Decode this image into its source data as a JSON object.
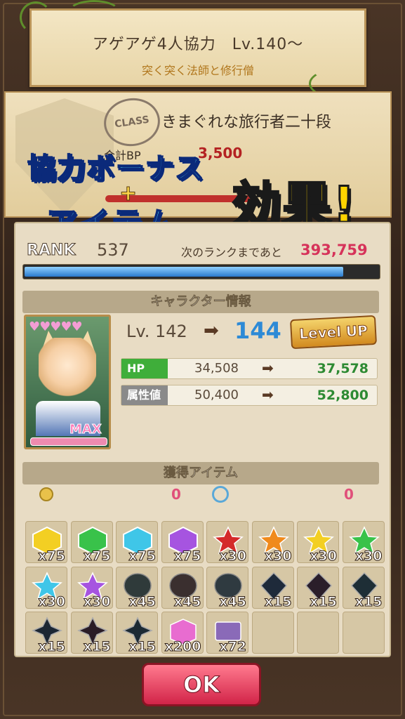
{
  "header": {
    "title": "アゲアゲ4人協力　Lv.140～",
    "subtitle": "突く突く法師と修行僧"
  },
  "class_panel": {
    "stamp": "CLASS",
    "class_name": "きまぐれな旅行者二十段",
    "bp_label": "合計BP",
    "bp_value": "3,500"
  },
  "overlay": {
    "line1": "協力ボーナス",
    "plus": "+",
    "line2": "アイテム",
    "line3": "効果!"
  },
  "rank": {
    "label": "RANK",
    "value": "537",
    "next_label": "次のランクまであと",
    "next_value": "393,759",
    "progress": 0.9
  },
  "character": {
    "section_title": "キャラクター情報",
    "hearts": "♥♥♥♥♥",
    "max_badge": "MAX",
    "level_old": "Lv. 142",
    "level_new": "144",
    "levelup_badge": "Level UP",
    "stats": [
      {
        "label": "HP",
        "old": "34,508",
        "new": "37,578",
        "color": "#3fae3a"
      },
      {
        "label": "属性値",
        "old": "50,400",
        "new": "52,800",
        "color": "#8a8a8a"
      }
    ]
  },
  "items": {
    "section_title": "獲得アイテム",
    "currency": [
      {
        "icon": "coin-icon",
        "value": "0"
      },
      {
        "icon": "swirl-icon",
        "value": "0"
      }
    ],
    "grid": [
      {
        "name": "yellow-gem-icon",
        "color": "#f3cf23",
        "qty": "x75"
      },
      {
        "name": "green-gem-icon",
        "color": "#39c24a",
        "qty": "x75"
      },
      {
        "name": "cyan-gem-icon",
        "color": "#3fc6e8",
        "qty": "x75"
      },
      {
        "name": "purple-gem-icon",
        "color": "#a654e0",
        "qty": "x75"
      },
      {
        "name": "red-star-icon",
        "color": "#d42a2a",
        "qty": "x30"
      },
      {
        "name": "orange-star-icon",
        "color": "#f08a1c",
        "qty": "x30"
      },
      {
        "name": "yellow-star-icon",
        "color": "#f3cf23",
        "qty": "x30"
      },
      {
        "name": "green-star-icon",
        "color": "#39c24a",
        "qty": "x30"
      },
      {
        "name": "cyan-star-icon",
        "color": "#3fc6e8",
        "qty": "x30"
      },
      {
        "name": "purple-star-icon",
        "color": "#a654e0",
        "qty": "x30"
      },
      {
        "name": "dark-orb-green-icon",
        "color": "#2f3a3a",
        "qty": "x45"
      },
      {
        "name": "dark-orb-orange-icon",
        "color": "#3a2f2f",
        "qty": "x45"
      },
      {
        "name": "dark-orb-cyan-icon",
        "color": "#2f3a40",
        "qty": "x45"
      },
      {
        "name": "dark-crystal-green-icon",
        "color": "#1e2a3a",
        "qty": "x15"
      },
      {
        "name": "dark-crystal-orange-icon",
        "color": "#2a1e2a",
        "qty": "x15"
      },
      {
        "name": "dark-crystal-cyan-icon",
        "color": "#1e2e36",
        "qty": "x15"
      },
      {
        "name": "dark-shard-green-icon",
        "color": "#1c2733",
        "qty": "x15"
      },
      {
        "name": "dark-shard-orange-icon",
        "color": "#2a1c26",
        "qty": "x15"
      },
      {
        "name": "dark-shard-cyan-icon",
        "color": "#1c2a33",
        "qty": "x15"
      },
      {
        "name": "rainbow-cube-icon",
        "color": "#e86cd0",
        "qty": "x200"
      },
      {
        "name": "ticket-icon",
        "color": "#8a6ab8",
        "qty": "x72"
      },
      {
        "name": "empty-slot",
        "color": "",
        "qty": ""
      },
      {
        "name": "empty-slot",
        "color": "",
        "qty": ""
      },
      {
        "name": "empty-slot",
        "color": "",
        "qty": ""
      }
    ]
  },
  "ok_button": "OK"
}
